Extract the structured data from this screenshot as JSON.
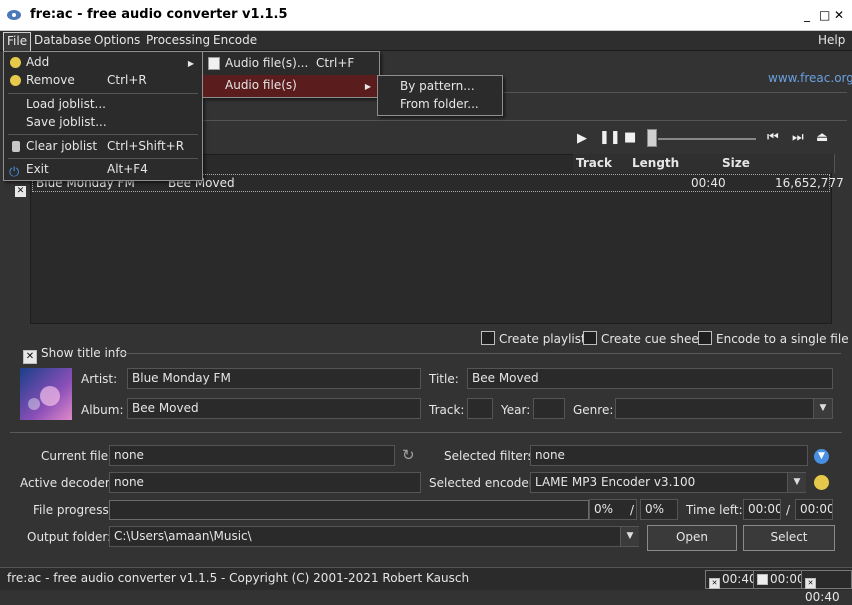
{
  "window": {
    "title": "fre:ac - free audio converter v1.1.5",
    "controls": [
      "_",
      "□",
      "✕"
    ]
  },
  "menubar": {
    "items": [
      "File",
      "Database",
      "Options",
      "Processing",
      "Encode"
    ],
    "help": "Help",
    "link": "www.freac.org"
  },
  "file_menu": {
    "items": [
      {
        "label": "Add",
        "shortcut": "",
        "submenu": true
      },
      {
        "label": "Remove",
        "shortcut": "Ctrl+R"
      },
      {
        "label": "Load joblist...",
        "shortcut": ""
      },
      {
        "label": "Save joblist...",
        "shortcut": ""
      },
      {
        "label": "Clear joblist",
        "shortcut": "Ctrl+Shift+R"
      },
      {
        "label": "Exit",
        "shortcut": "Alt+F4"
      }
    ]
  },
  "add_submenu": {
    "items": [
      {
        "label": "Audio file(s)...",
        "shortcut": "Ctrl+F"
      },
      {
        "label": "Audio file(s)",
        "shortcut": "",
        "submenu": true
      }
    ]
  },
  "audio_submenu": {
    "items": [
      "By pattern...",
      "From folder..."
    ]
  },
  "joblist": {
    "columns": [
      "Track",
      "Length",
      "Size"
    ],
    "rows": [
      {
        "artist": "Blue Monday FM",
        "title": "Bee Moved",
        "length": "00:40",
        "size": "16,652,777"
      }
    ]
  },
  "options": {
    "create_playlist": "Create playlist",
    "create_cue_sheet": "Create cue sheet",
    "encode_single": "Encode to a single file"
  },
  "title_info": {
    "toggle_label": "Show title info",
    "artist_label": "Artist:",
    "artist": "Blue Monday FM",
    "title_label": "Title:",
    "title": "Bee Moved",
    "album_label": "Album:",
    "album": "Bee Moved",
    "track_label": "Track:",
    "track": "",
    "year_label": "Year:",
    "year": "",
    "genre_label": "Genre:",
    "genre": ""
  },
  "status": {
    "current_file_label": "Current file:",
    "current_file": "none",
    "selected_filters_label": "Selected filters:",
    "selected_filters": "none",
    "active_decoder_label": "Active decoder:",
    "active_decoder": "none",
    "selected_encoder_label": "Selected encoder:",
    "selected_encoder": "LAME MP3 Encoder v3.100",
    "file_progress_label": "File progress:",
    "file_progress": "0%",
    "total_progress": "0%",
    "progress_separator": "/",
    "time_left_label": "Time left:",
    "time_left": "00:00",
    "time_total": "00:00",
    "output_folder_label": "Output folder:",
    "output_folder": "C:\\Users\\amaan\\Music\\",
    "open_button": "Open",
    "select_button": "Select"
  },
  "statusbar": {
    "copyright": "fre:ac - free audio converter v1.1.5 - Copyright (C) 2001-2021 Robert Kausch",
    "time1": "00:40",
    "time2": "00:00",
    "time3": "00:40"
  },
  "colors": {
    "background": "#333333",
    "menu_highlight": "#5a1c1c",
    "link": "#6aa0e0"
  }
}
